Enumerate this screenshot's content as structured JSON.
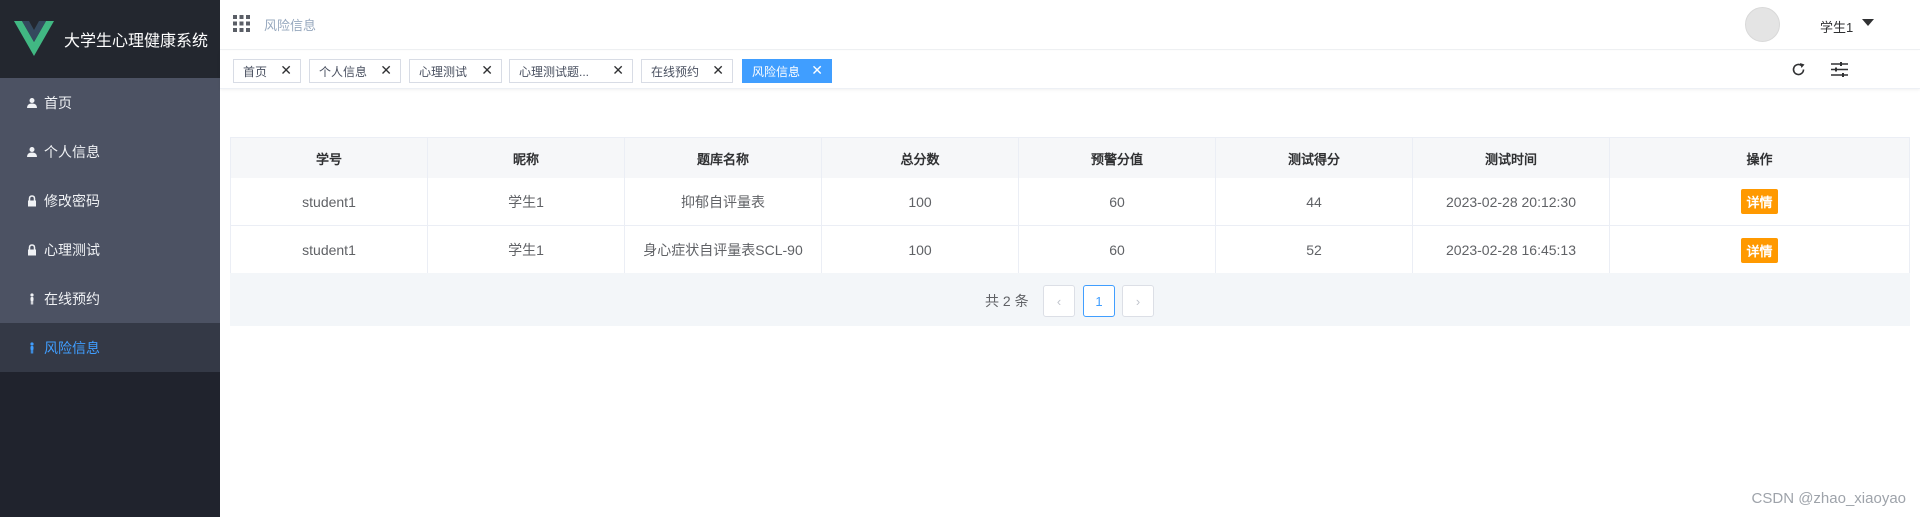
{
  "app": {
    "title": "大学生心理健康系统"
  },
  "colors": {
    "accent": "#409eff",
    "warning": "#ff9900",
    "sidebar_bg": "#20232d",
    "menu_bg": "#4c5263",
    "logo_green": "#41b883"
  },
  "sidebar": {
    "items": [
      {
        "label": "首页",
        "icon": "user-icon"
      },
      {
        "label": "个人信息",
        "icon": "user-icon"
      },
      {
        "label": "修改密码",
        "icon": "lock-icon"
      },
      {
        "label": "心理测试",
        "icon": "lock-icon"
      },
      {
        "label": "在线预约",
        "icon": "person-icon"
      },
      {
        "label": "风险信息",
        "icon": "person-icon",
        "active": true
      }
    ]
  },
  "header": {
    "breadcrumb": "风险信息",
    "user_name": "学生1"
  },
  "tags": [
    {
      "label": "首页"
    },
    {
      "label": "个人信息"
    },
    {
      "label": "心理测试"
    },
    {
      "label": "心理测试题..."
    },
    {
      "label": "在线预约"
    },
    {
      "label": "风险信息",
      "active": true
    }
  ],
  "table": {
    "headers": [
      "学号",
      "昵称",
      "题库名称",
      "总分数",
      "预警分值",
      "测试得分",
      "测试时间",
      "操作"
    ],
    "action_label": "详情",
    "rows": [
      [
        "student1",
        "学生1",
        "抑郁自评量表",
        "100",
        "60",
        "44",
        "2023-02-28 20:12:30"
      ],
      [
        "student1",
        "学生1",
        "身心症状自评量表SCL-90",
        "100",
        "60",
        "52",
        "2023-02-28 16:45:13"
      ]
    ]
  },
  "pagination": {
    "total_text": "共 2 条",
    "current_page": "1",
    "prev_label": "‹",
    "next_label": "›"
  },
  "watermark": "CSDN @zhao_xiaoyao"
}
